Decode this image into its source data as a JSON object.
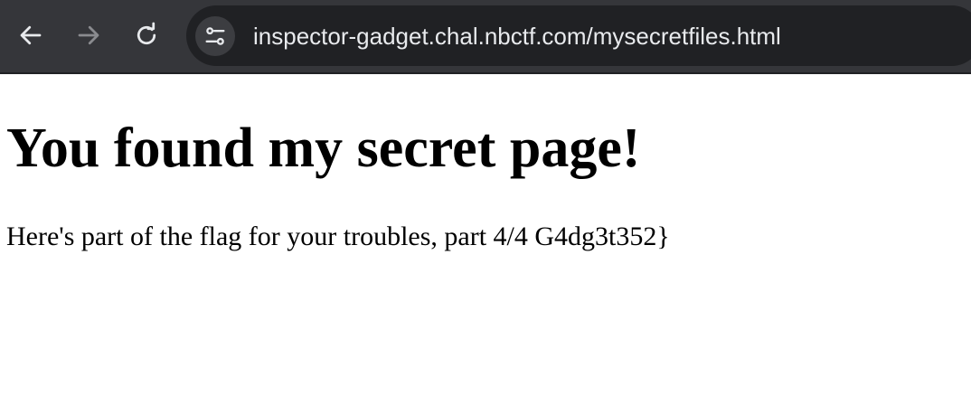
{
  "browser": {
    "url_host": "inspector-gadget.chal.nbctf.com",
    "url_path": "/mysecretfiles.html",
    "icons": {
      "back": "arrow-left-icon",
      "forward": "arrow-right-icon",
      "reload": "reload-icon",
      "site_info": "tune-settings-icon"
    },
    "colors": {
      "toolbar_bg": "#35363a",
      "omnibox_bg": "#202124",
      "icon_active": "#e8eaed",
      "icon_disabled": "#8a8b8f"
    }
  },
  "page": {
    "heading": "You found my secret page!",
    "paragraph": "Here's part of the flag for your troubles, part 4/4 G4dg3t352}"
  }
}
